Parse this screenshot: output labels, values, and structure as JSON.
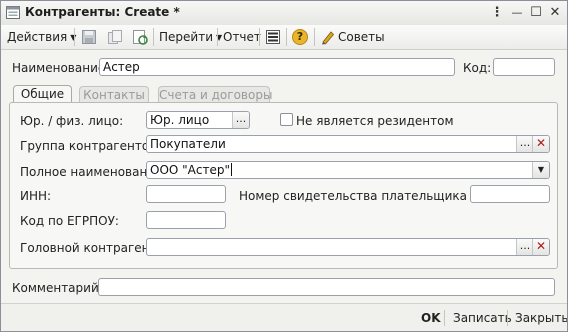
{
  "window": {
    "title": "Контрагенты: Create *",
    "controls": {
      "menu": "⋮",
      "minimize": "—",
      "maximize": "☐",
      "close": "✕"
    }
  },
  "toolbar": {
    "actions_label": "Действия",
    "goto_label": "Перейти",
    "report_label": "Отчет",
    "tips_label": "Советы",
    "help_glyph": "?"
  },
  "header": {
    "name_label": "Наименование:",
    "name_value": "Астер",
    "code_label": "Код:",
    "code_value": ""
  },
  "tabs": [
    {
      "label": "Общие",
      "active": true
    },
    {
      "label": "Контакты",
      "active": false
    },
    {
      "label": "Счета и договоры",
      "active": false
    }
  ],
  "general": {
    "legal_type_label": "Юр. / физ. лицо:",
    "legal_type_value": "Юр. лицо",
    "nonresident_label": "Не является резидентом",
    "nonresident_checked": false,
    "group_label": "Группа контрагентов:",
    "group_value": "Покупатели",
    "full_name_label": "Полное наименование:",
    "full_name_value": "ООО \"Астер\"",
    "inn_label": "ИНН:",
    "inn_value": "",
    "vat_cert_label": "Номер свидетельства плательщика НДС:",
    "vat_cert_value": "",
    "egrpou_label": "Код по ЕГРПОУ:",
    "egrpou_value": "",
    "parent_label": "Головной контрагент:",
    "parent_value": ""
  },
  "comment": {
    "label": "Комментарий:",
    "value": ""
  },
  "footer": {
    "ok_label": "OK",
    "save_label": "Записать",
    "close_label": "Закрыть"
  },
  "glyphs": {
    "select": "...",
    "clear": "✕",
    "dropdown": "▼",
    "toolbar_arrow": "▼"
  },
  "colors": {
    "clear_button": "#b01818",
    "tab_inactive_text": "#9a9a9a"
  }
}
